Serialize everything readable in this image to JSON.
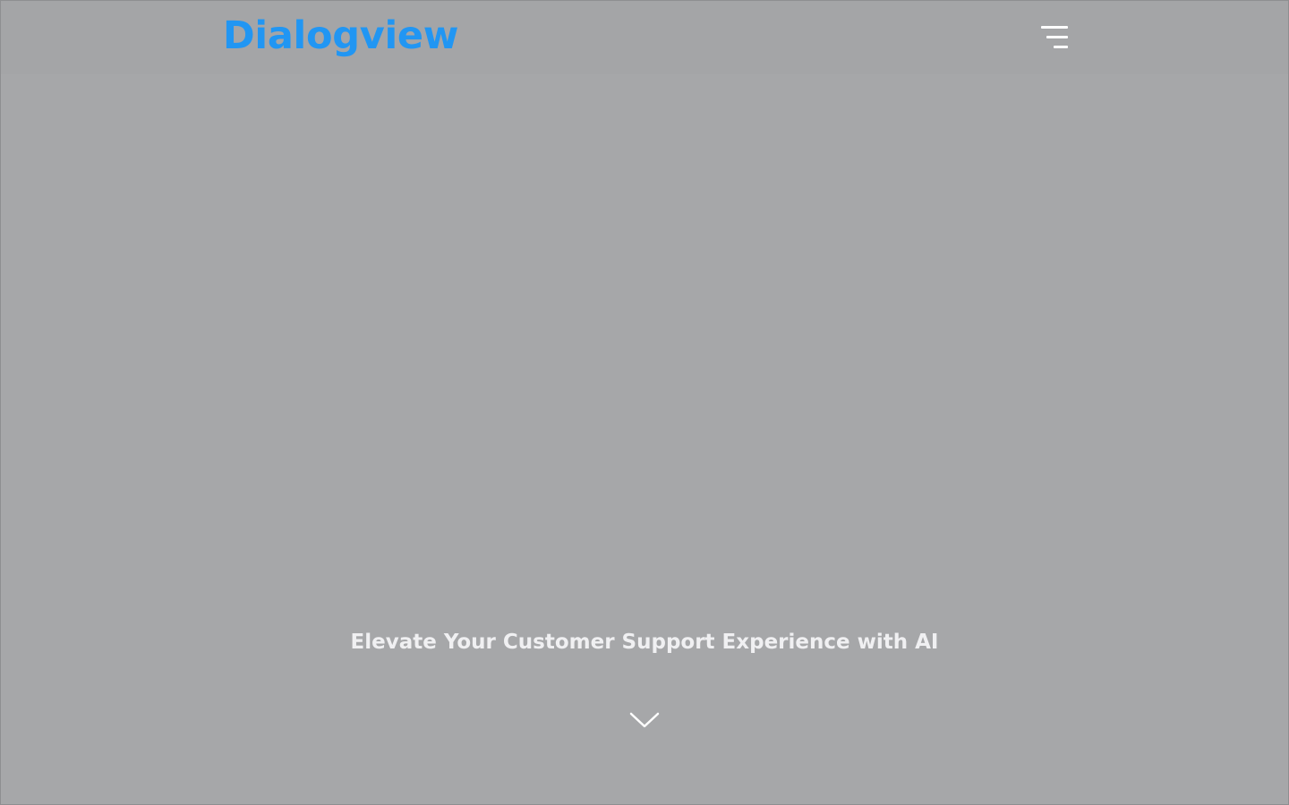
{
  "brand": {
    "name": "Dialogview",
    "color": "#2196f3"
  },
  "header": {
    "menu_icon": "hamburger-menu-icon"
  },
  "hero": {
    "title": "Elevate Your Customer Support Experience with AI",
    "scroll_icon": "chevron-down-icon"
  },
  "colors": {
    "background": "#a6a7a9",
    "text": "#f0f0f2",
    "icon": "#ffffff"
  }
}
